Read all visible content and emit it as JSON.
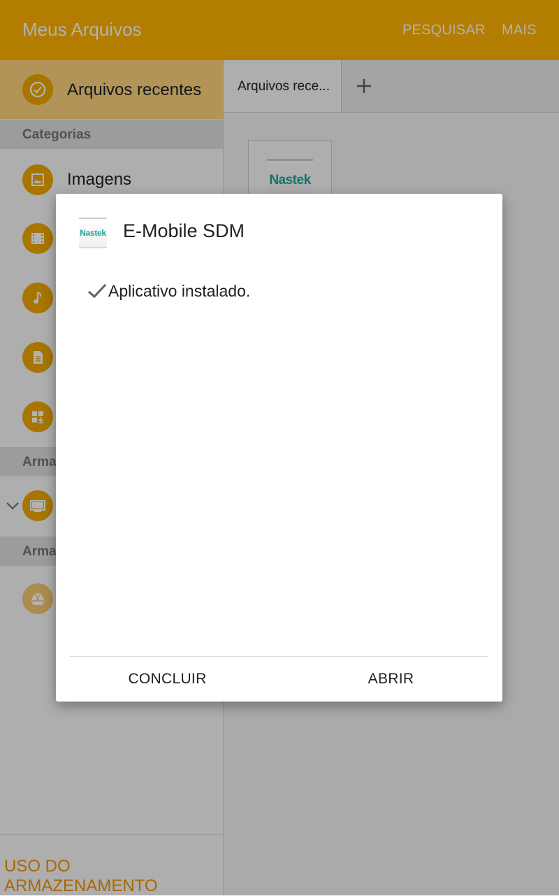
{
  "appbar": {
    "title": "Meus Arquivos",
    "search_label": "PESQUISAR",
    "more_label": "MAIS",
    "color": "#ffb300"
  },
  "sidebar": {
    "recent_label": "Arquivos recentes",
    "categories_header": "Categorias",
    "images_label": "Imagens",
    "device_storage_header_partial": "Arma",
    "cloud_storage_header_partial": "Arma",
    "storage_usage_label": "USO DO ARMAZENAMENTO",
    "icons": [
      "clock-check-icon",
      "image-icon",
      "video-icon",
      "music-icon",
      "document-icon",
      "download-apps-icon",
      "device-icon",
      "google-drive-icon"
    ]
  },
  "main": {
    "tab_label": "Arquivos rece...",
    "add_tab_icon": "plus-icon",
    "thumbnail_logo_text": "Nastek"
  },
  "dialog": {
    "icon_text": "Nastek",
    "title": "E-Mobile SDM",
    "message": "Aplicativo instalado.",
    "done_label": "CONCLUIR",
    "open_label": "ABRIR"
  }
}
